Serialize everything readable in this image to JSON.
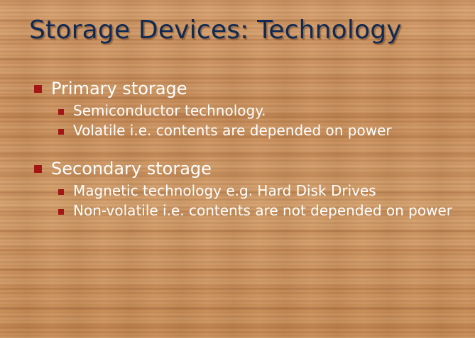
{
  "slide": {
    "title": "Storage Devices: Technology",
    "sections": [
      {
        "heading": "Primary storage",
        "items": [
          "Semiconductor technology.",
          "Volatile i.e. contents are depended on power"
        ]
      },
      {
        "heading": "Secondary storage",
        "items": [
          "Magnetic technology e.g. Hard Disk Drives",
          "Non-volatile i.e. contents are not depended on power"
        ]
      }
    ],
    "colors": {
      "title": "#0f2a54",
      "text": "#ffffff",
      "bullet": "#a31616",
      "background": "#c98f5b"
    },
    "bullet_icon": "square-bullet-icon"
  }
}
